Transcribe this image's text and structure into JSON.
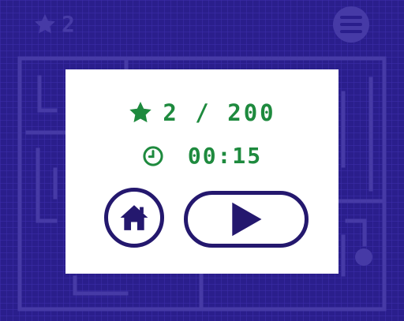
{
  "hud": {
    "stars_count": "2",
    "star_icon": "star-icon",
    "menu_icon": "menu-icon"
  },
  "dialog": {
    "stars_text": "2 / 200",
    "time_text": "00:15",
    "home_icon": "home-icon",
    "play_icon": "play-icon"
  },
  "colors": {
    "background": "#2a1e8c",
    "maze_wall": "#463aa6",
    "accent_green": "#1e8a3e",
    "button_navy": "#24186e",
    "dialog_bg": "#ffffff"
  }
}
